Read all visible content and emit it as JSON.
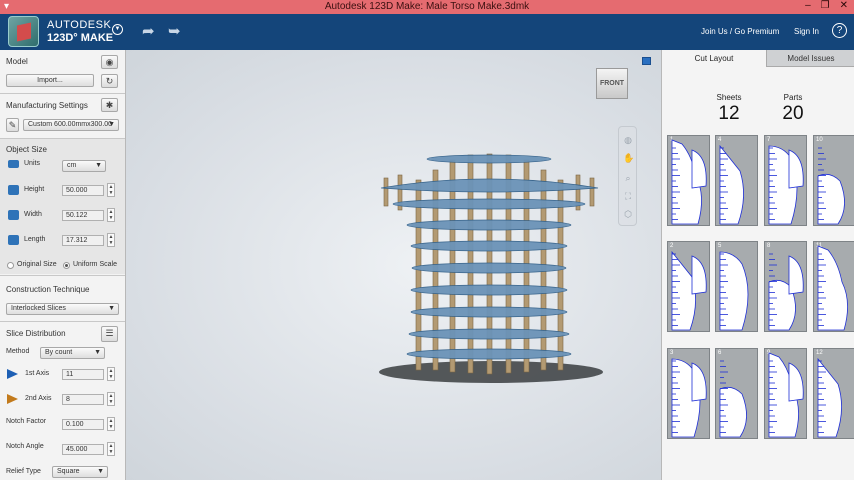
{
  "window": {
    "title": "Autodesk 123D Make: Male Torso Make.3dmk",
    "minimize": "‒",
    "restore": "❐",
    "close": "✕"
  },
  "header": {
    "brand_line1": "AUTODESK",
    "brand_line2": "123D° MAKE",
    "join_label": "Join Us / Go Premium",
    "signin_label": "Sign In",
    "help_label": "?"
  },
  "model": {
    "title": "Model",
    "import_label": "Import..."
  },
  "manufacturing": {
    "title": "Manufacturing Settings",
    "preset": "Custom 600.00mmx300.00"
  },
  "object_size": {
    "title": "Object Size",
    "units_label": "Units",
    "units_value": "cm",
    "height_label": "Height",
    "height_value": "50.000",
    "width_label": "Width",
    "width_value": "50.122",
    "length_label": "Length",
    "length_value": "17.312",
    "original_size_label": "Original Size",
    "uniform_scale_label": "Uniform Scale"
  },
  "construction": {
    "title": "Construction Technique",
    "value": "Interlocked Slices"
  },
  "slice_distribution": {
    "title": "Slice Distribution",
    "method_label": "Method",
    "method_value": "By count",
    "axis1_label": "1st Axis",
    "axis1_value": "11",
    "axis2_label": "2nd Axis",
    "axis2_value": "8",
    "notch_factor_label": "Notch Factor",
    "notch_factor_value": "0.100",
    "notch_angle_label": "Notch Angle",
    "notch_angle_value": "45.000",
    "relief_type_label": "Relief Type",
    "relief_type_value": "Square"
  },
  "viewport": {
    "view_cube_label": "FRONT"
  },
  "cut_layout": {
    "tabs": [
      "Cut Layout",
      "Model Issues"
    ],
    "sheets_label": "Sheets",
    "sheets_value": "12",
    "parts_label": "Parts",
    "parts_value": "20",
    "sheet_numbers": [
      "1",
      "4",
      "7",
      "10",
      "2",
      "5",
      "8",
      "11",
      "3",
      "6",
      "9",
      "12"
    ]
  },
  "colors": {
    "header_bg": "#14457a",
    "titlebar_bg": "#e56b70",
    "slice_blue": "#3a7fc1",
    "slice_tan": "#b39a72",
    "cut_line": "#1f2fd6"
  }
}
